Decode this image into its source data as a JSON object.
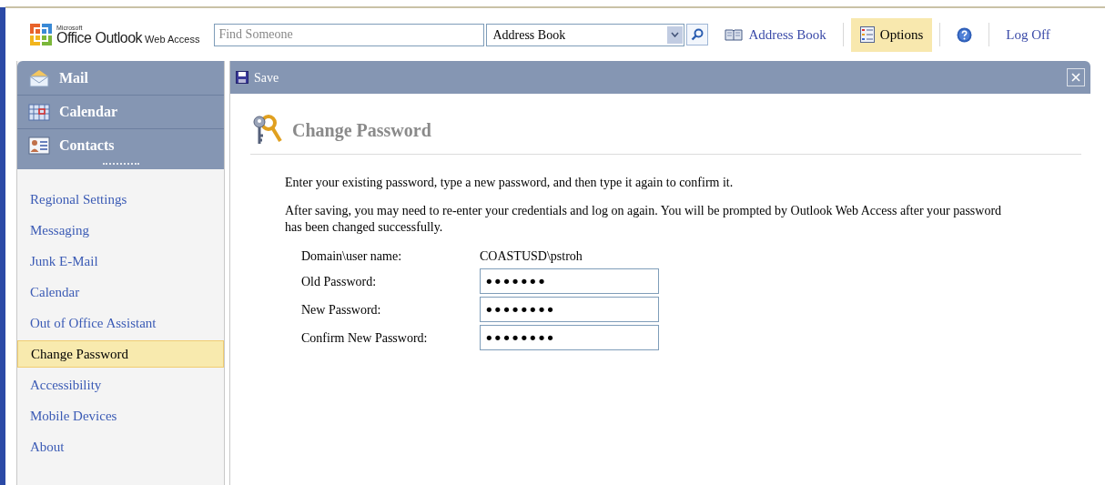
{
  "header": {
    "logo": {
      "maker": "Microsoft",
      "product": "Office Outlook",
      "suffix": "Web Access"
    },
    "search": {
      "placeholder": "Find Someone"
    },
    "directory": {
      "value": "Address Book"
    },
    "links": [
      {
        "kind": "addressbook",
        "label": "Address Book",
        "selected": false
      },
      {
        "kind": "options",
        "label": "Options",
        "selected": true
      },
      {
        "kind": "help",
        "selected": false
      },
      {
        "kind": "logoff",
        "label": "Log Off",
        "selected": false
      }
    ]
  },
  "modules": [
    {
      "kind": "mail",
      "label": "Mail"
    },
    {
      "kind": "calendar",
      "label": "Calendar"
    },
    {
      "kind": "contacts",
      "label": "Contacts"
    }
  ],
  "options": [
    {
      "label": "Regional Settings",
      "selected": false
    },
    {
      "label": "Messaging",
      "selected": false
    },
    {
      "label": "Junk E-Mail",
      "selected": false
    },
    {
      "label": "Calendar",
      "selected": false
    },
    {
      "label": "Out of Office Assistant",
      "selected": false
    },
    {
      "label": "Change Password",
      "selected": true
    },
    {
      "label": "Accessibility",
      "selected": false
    },
    {
      "label": "Mobile Devices",
      "selected": false
    },
    {
      "label": "About",
      "selected": false
    }
  ],
  "toolbar": {
    "save": "Save"
  },
  "page": {
    "title": "Change Password",
    "intro": "Enter your existing password, type a new password, and then type it again to confirm it.",
    "note": "After saving, you may need to re-enter your credentials and log on again. You will be prompted by Outlook Web Access after your password has been changed successfully.",
    "fields": [
      {
        "kind": "static",
        "label": "Domain\\user name:",
        "value": "COASTUSD\\pstroh"
      },
      {
        "kind": "password",
        "label": "Old Password:",
        "value": "•••••••"
      },
      {
        "kind": "password",
        "label": "New Password:",
        "value": "••••••••"
      },
      {
        "kind": "password",
        "label": "Confirm New Password:",
        "value": "••••••••"
      }
    ]
  }
}
